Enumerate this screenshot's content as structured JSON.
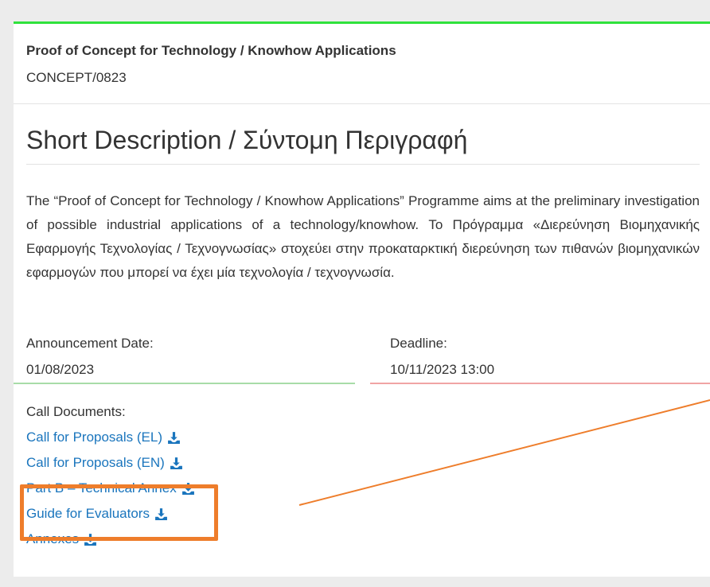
{
  "header": {
    "title": "Proof of Concept for Technology / Knowhow Applications",
    "code": "CONCEPT/0823"
  },
  "section": {
    "title": "Short Description / Σύντομη Περιγραφή",
    "description": "The “Proof of Concept for Technology / Knowhow Applications” Programme aims at the preliminary investigation of possible industrial applications of a technology/knowhow. Το Πρόγραμμα «Διερεύνηση Βιομηχανικής Εφαρμογής Τεχνολογίας / Τεχνογνωσίας» στοχεύει στην προκαταρκτική διερεύνηση των πιθανών βιομηχανικών εφαρμογών που μπορεί να έχει μία τεχνολογία / τεχνογνωσία."
  },
  "dates": {
    "announcement_label": "Announcement Date:",
    "announcement_value": "01/08/2023",
    "deadline_label": "Deadline:",
    "deadline_value": "10/11/2023 13:00"
  },
  "documents": {
    "label": "Call Documents:",
    "items": [
      {
        "label": "Call for Proposals (EL)",
        "icon": "download-icon"
      },
      {
        "label": "Call for Proposals (EN)",
        "icon": "download-icon"
      },
      {
        "label": "Part B – Technical Annex",
        "icon": "download-icon"
      },
      {
        "label": "Guide for Evaluators",
        "icon": "download-icon"
      },
      {
        "label": "Annexes",
        "icon": "download-icon"
      }
    ]
  },
  "colors": {
    "top_border": "#2fe23c",
    "link": "#1a75bd",
    "highlight": "#ee7d2b",
    "announcement_underline": "#a8dca8",
    "deadline_underline": "#f0a4a4"
  }
}
